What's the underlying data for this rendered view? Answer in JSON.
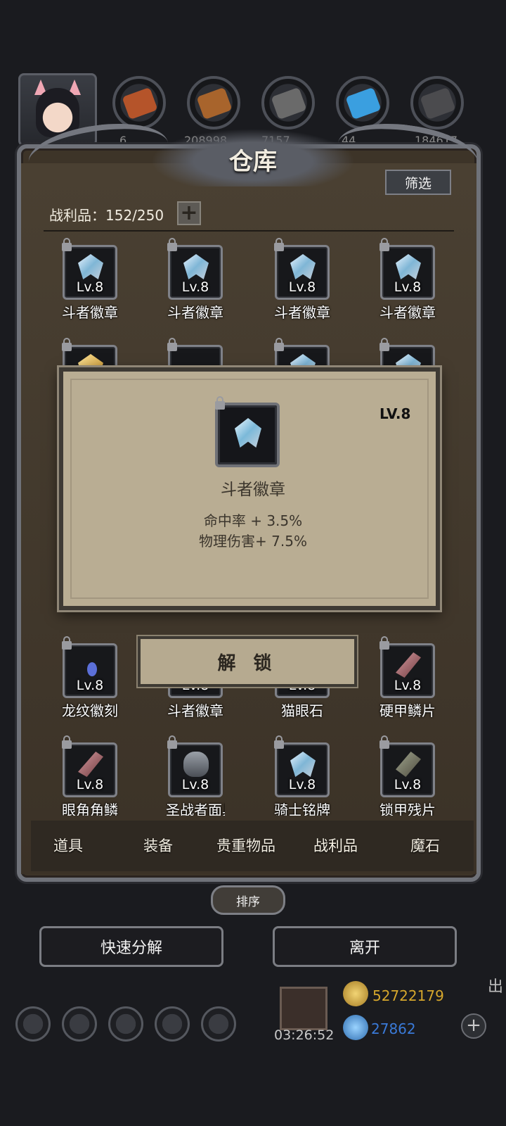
{
  "hud": {
    "resources": [
      {
        "icon": "meat-icon",
        "color": "#b5542a",
        "value": "6"
      },
      {
        "icon": "wood-icon",
        "color": "#a8642c",
        "value": "208998"
      },
      {
        "icon": "iron-icon",
        "color": "#6a6a6a",
        "value": "7157"
      },
      {
        "icon": "crystal-icon",
        "color": "#3a9fe0",
        "value": "44"
      },
      {
        "icon": "stone-icon",
        "color": "#4b4b4e",
        "value": "184617"
      }
    ]
  },
  "panel": {
    "title": "仓库",
    "filter_label": "筛选",
    "loot_label": "战利品：152/250",
    "plus_label": "+"
  },
  "grid": {
    "row1": [
      {
        "lv": "Lv.8",
        "name": "斗者徽章"
      },
      {
        "lv": "Lv.8",
        "name": "斗者徽章"
      },
      {
        "lv": "Lv.8",
        "name": "斗者徽章"
      },
      {
        "lv": "Lv.8",
        "name": "斗者徽章"
      }
    ],
    "row4": [
      {
        "lv": "Lv.8",
        "name": "龙纹徽刻"
      },
      {
        "lv": "Lv.8",
        "name": "斗者徽章"
      },
      {
        "lv": "Lv.8",
        "name": "猫眼石"
      },
      {
        "lv": "Lv.8",
        "name": "硬甲鳞片"
      }
    ],
    "row5": [
      {
        "lv": "Lv.8",
        "name": "眼角角鳞"
      },
      {
        "lv": "Lv.8",
        "name": "圣战者面具"
      },
      {
        "lv": "Lv.8",
        "name": "骑士铭牌"
      },
      {
        "lv": "Lv.8",
        "name": "锁甲残片"
      }
    ]
  },
  "popup": {
    "level": "LV.8",
    "name": "斗者徽章",
    "stat1": "命中率 + 3.5%",
    "stat2": "物理伤害+ 7.5%"
  },
  "unlock_label": "解 锁",
  "tabs": [
    "道具",
    "装备",
    "贵重物品",
    "战利品",
    "魔石"
  ],
  "active_tab": "战利品",
  "sort_label": "排序",
  "actions": {
    "decompose_label": "快速分解",
    "leave_label": "离开"
  },
  "bottom": {
    "timer": "03:26:52",
    "gold": "52722179",
    "gems": "27862",
    "exit_partial": "出"
  },
  "colors": {
    "panel_bg": "#3d3428",
    "popup_bg": "#b9ad93",
    "gold_text": "#d6a72c",
    "gem_text": "#3a7ad8"
  }
}
